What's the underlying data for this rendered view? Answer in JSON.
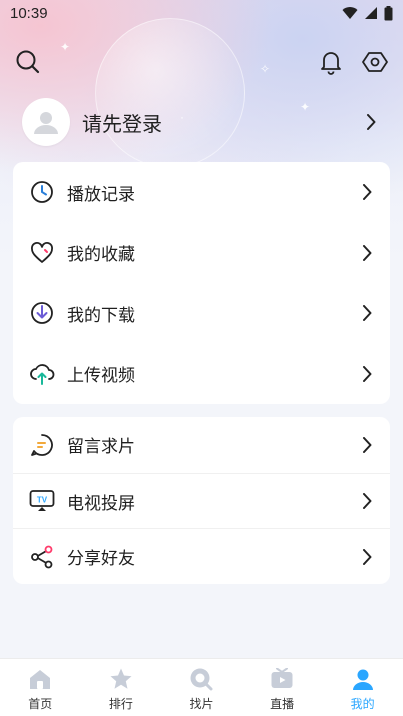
{
  "status_bar": {
    "time": "10:39"
  },
  "profile": {
    "login_prompt": "请先登录"
  },
  "menu_group_1": [
    {
      "label": "播放记录",
      "icon": "history-clock-icon"
    },
    {
      "label": "我的收藏",
      "icon": "heart-icon"
    },
    {
      "label": "我的下载",
      "icon": "download-icon"
    },
    {
      "label": "上传视频",
      "icon": "upload-cloud-icon"
    }
  ],
  "menu_group_2": [
    {
      "label": "留言求片",
      "icon": "message-icon"
    },
    {
      "label": "电视投屏",
      "icon": "tv-cast-icon"
    },
    {
      "label": "分享好友",
      "icon": "share-icon"
    }
  ],
  "tabbar": [
    {
      "label": "首页",
      "icon": "home-icon"
    },
    {
      "label": "排行",
      "icon": "star-icon"
    },
    {
      "label": "找片",
      "icon": "search-film-icon"
    },
    {
      "label": "直播",
      "icon": "live-icon"
    },
    {
      "label": "我的",
      "icon": "profile-icon",
      "active": true
    }
  ],
  "colors": {
    "accent": "#2aa6ff",
    "download_icon": "#6b5bd6",
    "upload_icon": "#19b89a",
    "message_icon": "#f2a93b",
    "share_icon": "#ff3b6b",
    "history_icon": "#2a7fd9"
  }
}
